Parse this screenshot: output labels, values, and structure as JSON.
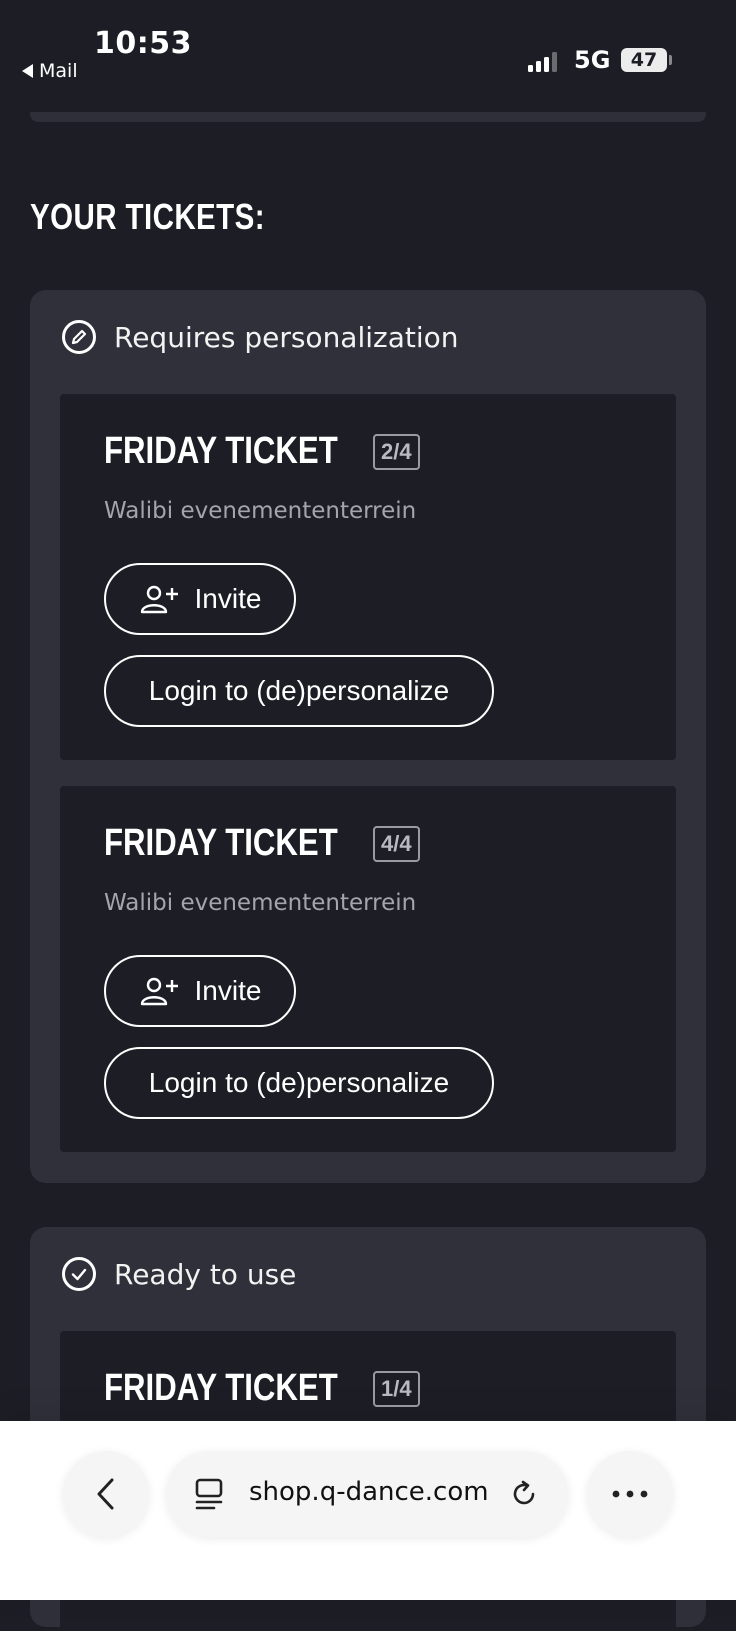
{
  "status_bar": {
    "time": "10:53",
    "back_app": "Mail",
    "network": "5G",
    "battery": "47"
  },
  "section_title": "YOUR TICKETS:",
  "groups": [
    {
      "header": "Requires personalization",
      "header_icon": "pencil-circle-icon",
      "tickets": [
        {
          "title": "FRIDAY TICKET",
          "count": "2/4",
          "venue": "Walibi evenemententerrein",
          "invite_label": "Invite",
          "login_label": "Login to (de)personalize"
        },
        {
          "title": "FRIDAY TICKET",
          "count": "4/4",
          "venue": "Walibi evenemententerrein",
          "invite_label": "Invite",
          "login_label": "Login to (de)personalize"
        }
      ]
    },
    {
      "header": "Ready to use",
      "header_icon": "check-circle-icon",
      "tickets": [
        {
          "title": "FRIDAY TICKET",
          "count": "1/4"
        }
      ]
    }
  ],
  "browser": {
    "url": "shop.q-dance.com"
  },
  "colors": {
    "background": "#1d1e25",
    "group": "#2f3039",
    "text": "#ffffff",
    "muted": "#a4a5ab"
  }
}
